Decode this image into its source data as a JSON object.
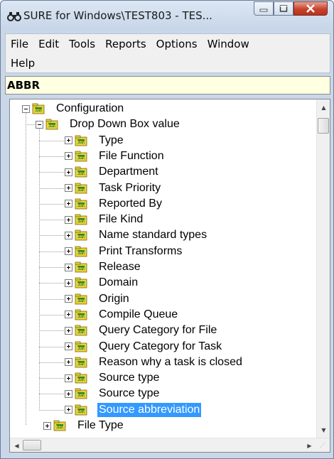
{
  "window": {
    "title": "SURE for Windows\\TEST803 - TES...",
    "app_icon": "binoculars-icon",
    "buttons": {
      "minimize": "minimize-icon",
      "maximize": "maximize-icon",
      "close": "close-icon"
    }
  },
  "menu": {
    "items": [
      "File",
      "Edit",
      "Tools",
      "Reports",
      "Options",
      "Window",
      "Help"
    ]
  },
  "abbr_field": {
    "value": "ABBR"
  },
  "tree": {
    "root": {
      "label": "Configuration",
      "expanded": true
    },
    "group": {
      "label": "Drop Down Box value",
      "expanded": true
    },
    "children": [
      {
        "label": "Type"
      },
      {
        "label": "File Function"
      },
      {
        "label": "Department"
      },
      {
        "label": "Task Priority"
      },
      {
        "label": "Reported By"
      },
      {
        "label": "File Kind"
      },
      {
        "label": "Name standard types"
      },
      {
        "label": "Print Transforms"
      },
      {
        "label": "Release"
      },
      {
        "label": "Domain"
      },
      {
        "label": "Origin"
      },
      {
        "label": "Compile Queue"
      },
      {
        "label": "Query Category for File"
      },
      {
        "label": "Query Category for Task"
      },
      {
        "label": "Reason why a task is closed"
      },
      {
        "label": "Source type"
      },
      {
        "label": "Source type"
      },
      {
        "label": "Source abbreviation",
        "selected": true
      }
    ],
    "sibling": {
      "label": "File Type"
    },
    "selection_color": "#3399ff",
    "node_icon": "folder-key-icon"
  }
}
